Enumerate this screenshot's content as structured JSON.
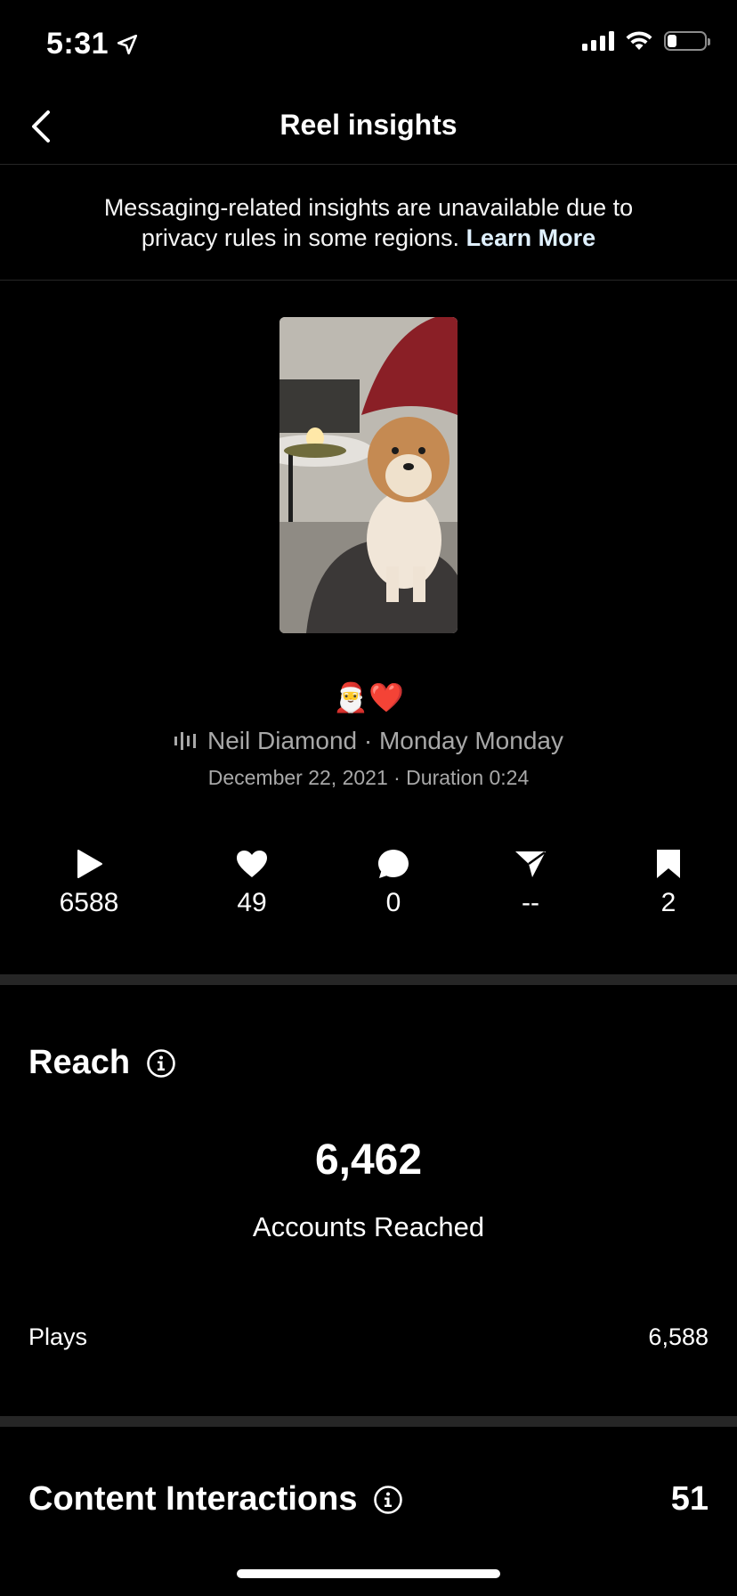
{
  "status_bar": {
    "time": "5:31"
  },
  "header": {
    "title": "Reel insights"
  },
  "notice": {
    "text": "Messaging-related insights are unavailable due to privacy rules in some regions.",
    "link": "Learn More"
  },
  "reel": {
    "caption_emoji": "🎅❤️",
    "audio": "Neil Diamond · Monday Monday",
    "date_duration": "December 22, 2021 · Duration 0:24"
  },
  "stats": [
    {
      "icon": "play-icon",
      "value": "6588"
    },
    {
      "icon": "heart-icon",
      "value": "49"
    },
    {
      "icon": "comment-icon",
      "value": "0"
    },
    {
      "icon": "share-icon",
      "value": "--"
    },
    {
      "icon": "bookmark-icon",
      "value": "2"
    }
  ],
  "reach": {
    "title": "Reach",
    "accounts_reached": "6,462",
    "accounts_reached_label": "Accounts Reached",
    "plays_label": "Plays",
    "plays_value": "6,588"
  },
  "content_interactions": {
    "title": "Content Interactions",
    "value": "51"
  },
  "colors": {
    "background": "#000000",
    "text": "#ffffff",
    "secondary_text": "#a8a8a8",
    "divider": "#262626"
  }
}
